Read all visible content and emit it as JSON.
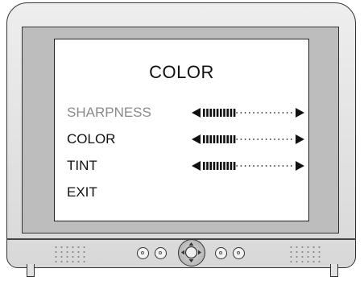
{
  "osd": {
    "title": "COLOR",
    "items": [
      {
        "label": "SHARPNESS",
        "selected": true,
        "level": 0.35
      },
      {
        "label": "COLOR",
        "selected": false,
        "level": 0.35
      },
      {
        "label": "TINT",
        "selected": false,
        "level": 0.35
      },
      {
        "label": "EXIT",
        "selected": false
      }
    ]
  },
  "colors": {
    "screen_bg": "#ffffff",
    "bezel": "#bdbdbd",
    "body": "#e4e4e4",
    "selected_text": "#8a8a8a",
    "text": "#111111"
  },
  "controls": {
    "icons": [
      "left-arrow-icon",
      "right-arrow-icon",
      "joystick-icon"
    ]
  }
}
